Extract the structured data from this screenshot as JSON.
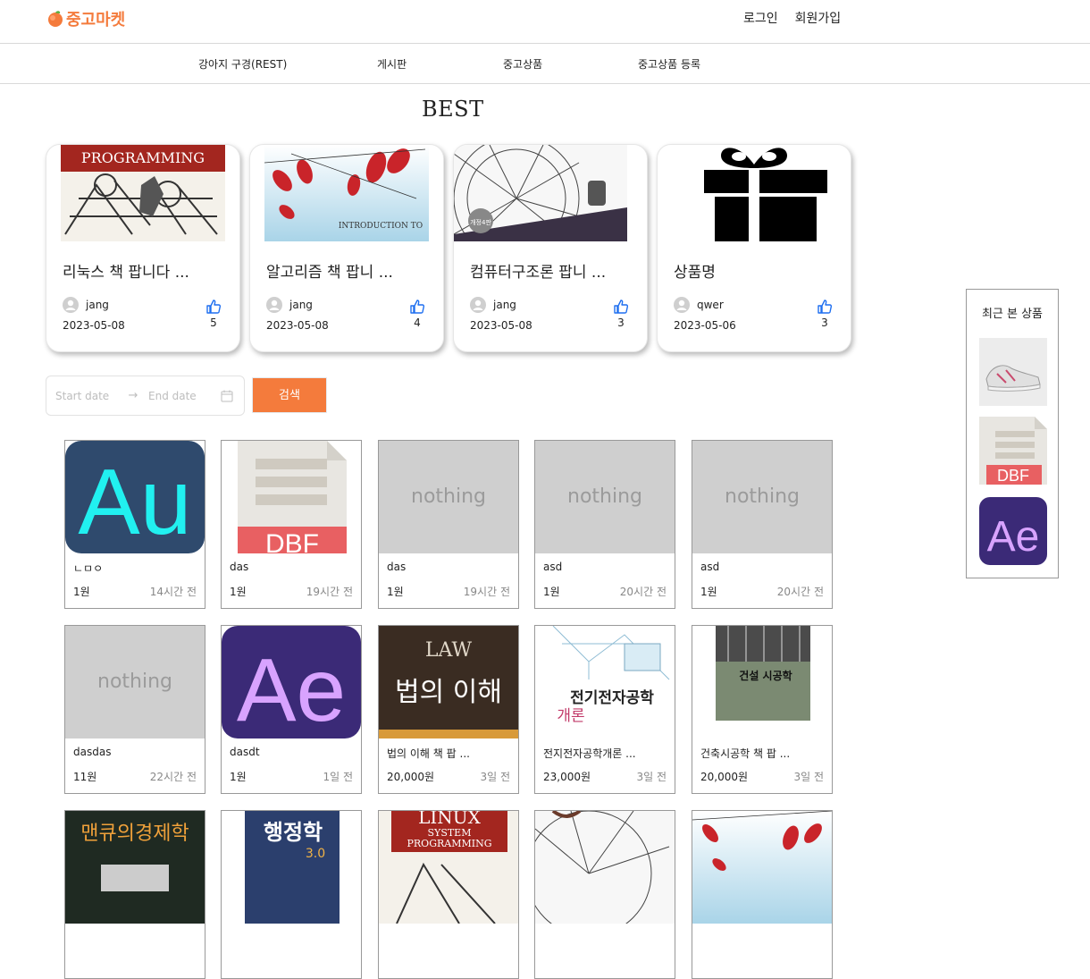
{
  "header": {
    "logo_text": "중고마켓",
    "login_label": "로그인",
    "signup_label": "회원가입"
  },
  "nav": {
    "items": [
      {
        "label": "강아지 구경(REST)"
      },
      {
        "label": "게시판"
      },
      {
        "label": "중고상품"
      },
      {
        "label": "중고상품 등록"
      }
    ]
  },
  "best": {
    "title": "BEST",
    "cards": [
      {
        "name": "리눅스 책 팝니다 ...",
        "user": "jang",
        "date": "2023-05-08",
        "likes": "5",
        "image": "linux-book-cover",
        "image_text": "PROGRAMMING"
      },
      {
        "name": "알고리즘 책 팝니 ...",
        "user": "jang",
        "date": "2023-05-08",
        "likes": "4",
        "image": "algorithms-book-cover",
        "image_text": "INTRODUCTION TO"
      },
      {
        "name": "컴퓨터구조론 팝니 ...",
        "user": "jang",
        "date": "2023-05-08",
        "likes": "3",
        "image": "ferris-wheel-cover",
        "image_text": "개정4판"
      },
      {
        "name": "상품명",
        "user": "qwer",
        "date": "2023-05-06",
        "likes": "3",
        "image": "gift-icon"
      }
    ]
  },
  "search": {
    "start_placeholder": "Start date",
    "end_placeholder": "End date",
    "button_label": "검색"
  },
  "products": [
    {
      "name": "ㄴㅁㅇ",
      "price": "1원",
      "time": "14시간 전",
      "image": "au-logo",
      "image_text": "Au"
    },
    {
      "name": "das",
      "price": "1원",
      "time": "19시간 전",
      "image": "dbf-file-icon",
      "image_text": "DBF"
    },
    {
      "name": "das",
      "price": "1원",
      "time": "19시간 전",
      "image": "placeholder",
      "image_text": "nothing"
    },
    {
      "name": "asd",
      "price": "1원",
      "time": "20시간 전",
      "image": "placeholder",
      "image_text": "nothing"
    },
    {
      "name": "asd",
      "price": "1원",
      "time": "20시간 전",
      "image": "placeholder",
      "image_text": "nothing"
    },
    {
      "name": "dasdas",
      "price": "11원",
      "time": "22시간 전",
      "image": "placeholder",
      "image_text": "nothing"
    },
    {
      "name": "dasdt",
      "price": "1원",
      "time": "1일 전",
      "image": "ae-logo",
      "image_text": "Ae"
    },
    {
      "name": "법의 이해 책 팝 ...",
      "price": "20,000원",
      "time": "3일 전",
      "image": "law-book-cover",
      "image_text": "법의 이해"
    },
    {
      "name": "전지전자공학개론 ...",
      "price": "23,000원",
      "time": "3일 전",
      "image": "electronics-book-cover",
      "image_text": "전기전자공학"
    },
    {
      "name": "건축시공학 책 팝 ...",
      "price": "20,000원",
      "time": "3일 전",
      "image": "construction-book-cover",
      "image_text": "건설 시공학"
    },
    {
      "image": "economics-book-cover",
      "image_text": "맨큐의경제학"
    },
    {
      "image": "administration-book-cover",
      "image_text": "행정학"
    },
    {
      "image": "linux-book-cover",
      "image_text": "LINUX"
    },
    {
      "image": "ferris-wheel-cover"
    },
    {
      "image": "algorithms-book-cover"
    }
  ],
  "recent": {
    "title": "최근 본 상품",
    "items": [
      {
        "image": "sneaker-photo"
      },
      {
        "image": "dbf-file-icon",
        "image_text": "DBF"
      },
      {
        "image": "ae-logo",
        "image_text": "Ae"
      }
    ]
  },
  "colors": {
    "accent": "#f47b3c",
    "au_bg": "#2f4a6d",
    "au_fg": "#21f0f0",
    "ae_bg": "#3b2a77",
    "ae_fg": "#d8a3ff",
    "placeholder": "#cfcfcf"
  }
}
